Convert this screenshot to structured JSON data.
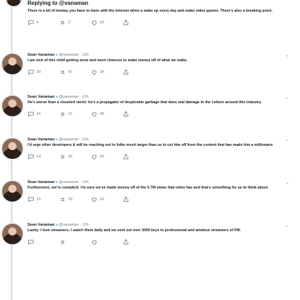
{
  "replying_to": "Replying to @vanaman",
  "first_reply": {
    "body": "There is a bit of leeway you have to have with the internet when u wake up every day and make video games. There's also a breaking point.",
    "actions": {
      "replies": "6",
      "retweets": "2",
      "likes": "1K"
    }
  },
  "tweets": [
    {
      "name": "Sean Vanaman",
      "handle": "@vanaman",
      "time": "12h",
      "body": "I am sick of this child getting more and more chances to make money off of what we make.",
      "actions": {
        "replies": "20",
        "retweets": "47",
        "likes": "3K"
      }
    },
    {
      "name": "Sean Vanaman",
      "handle": "@vanaman",
      "time": "12h",
      "body": "He's worse than a closeted racist: he's a propagator of despicable garbage that does real damage to the culture around this industry.",
      "actions": {
        "replies": "16",
        "retweets": "27",
        "likes": "3K"
      }
    },
    {
      "name": "Sean Vanaman",
      "handle": "@vanaman",
      "time": "12h",
      "body": "I'd urge other developers & will be reaching out to folks much larger than us to cut him off from the content that has made him a millionaire",
      "actions": {
        "replies": "24",
        "retweets": "35",
        "likes": "2K"
      }
    },
    {
      "name": "Sean Vanaman",
      "handle": "@vanaman",
      "time": "12h",
      "body": "Furthermore, we're complicit: I'm sure we've made money off of the 5.7M views that video has and that's something for us to think about.",
      "actions": {
        "replies": "16",
        "retweets": "18",
        "likes": "1K"
      }
    },
    {
      "name": "Sean Vanaman",
      "handle": "@vanaman",
      "time": "12h",
      "body": "Lastly: I love streamers. I watch them daily and we sent out over 3000 keys to professional and amateur streamers of FW.",
      "actions": {
        "replies": "",
        "retweets": "",
        "likes": ""
      }
    }
  ]
}
